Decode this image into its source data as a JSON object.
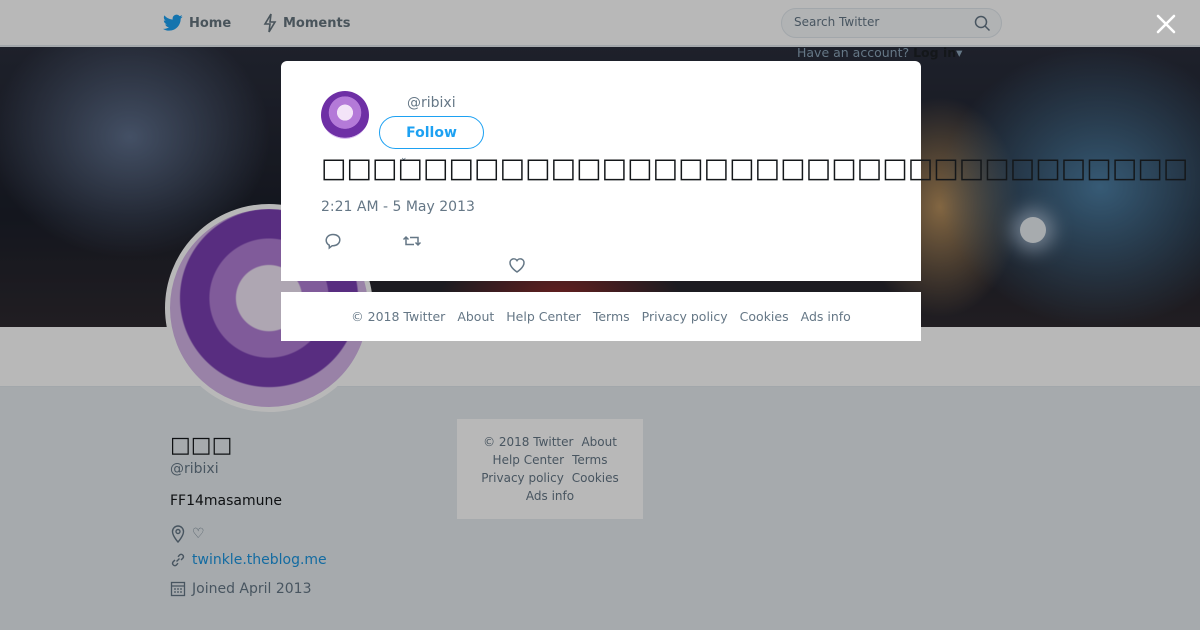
{
  "nav": {
    "home_label": "Home",
    "moments_label": "Moments",
    "search_placeholder": "Search Twitter",
    "account_prompt": "Have an account?",
    "login_label": "Log in"
  },
  "profile": {
    "name": "□□□",
    "handle": "@ribixi",
    "bio": "FF14masamune",
    "location": "♡",
    "url": "twinkle.theblog.me",
    "joined": "Joined April 2013"
  },
  "side_footer": {
    "copyright": "© 2018 Twitter",
    "about": "About",
    "help": "Help Center",
    "terms": "Terms",
    "privacy": "Privacy policy",
    "cookies": "Cookies",
    "ads": "Ads info"
  },
  "tweet": {
    "handle": "@ribixi",
    "follow_label": "Follow",
    "text": "□□□□□□□□□□□□□□□□□□□□□□□□□□□□□□□□□□",
    "timestamp": "2:21 AM - 5 May 2013"
  },
  "modal_footer": {
    "copyright": "© 2018 Twitter",
    "about": "About",
    "help": "Help Center",
    "terms": "Terms",
    "privacy": "Privacy policy",
    "cookies": "Cookies",
    "ads": "Ads info"
  },
  "colors": {
    "twitter_blue": "#1da1f2",
    "link_blue": "#1b95e0",
    "text_gray": "#657786"
  },
  "icons": [
    "twitter-bird-icon",
    "moments-bolt-icon",
    "search-icon",
    "close-icon",
    "location-pin-icon",
    "link-icon",
    "calendar-icon",
    "reply-icon",
    "retweet-icon",
    "like-heart-icon"
  ]
}
